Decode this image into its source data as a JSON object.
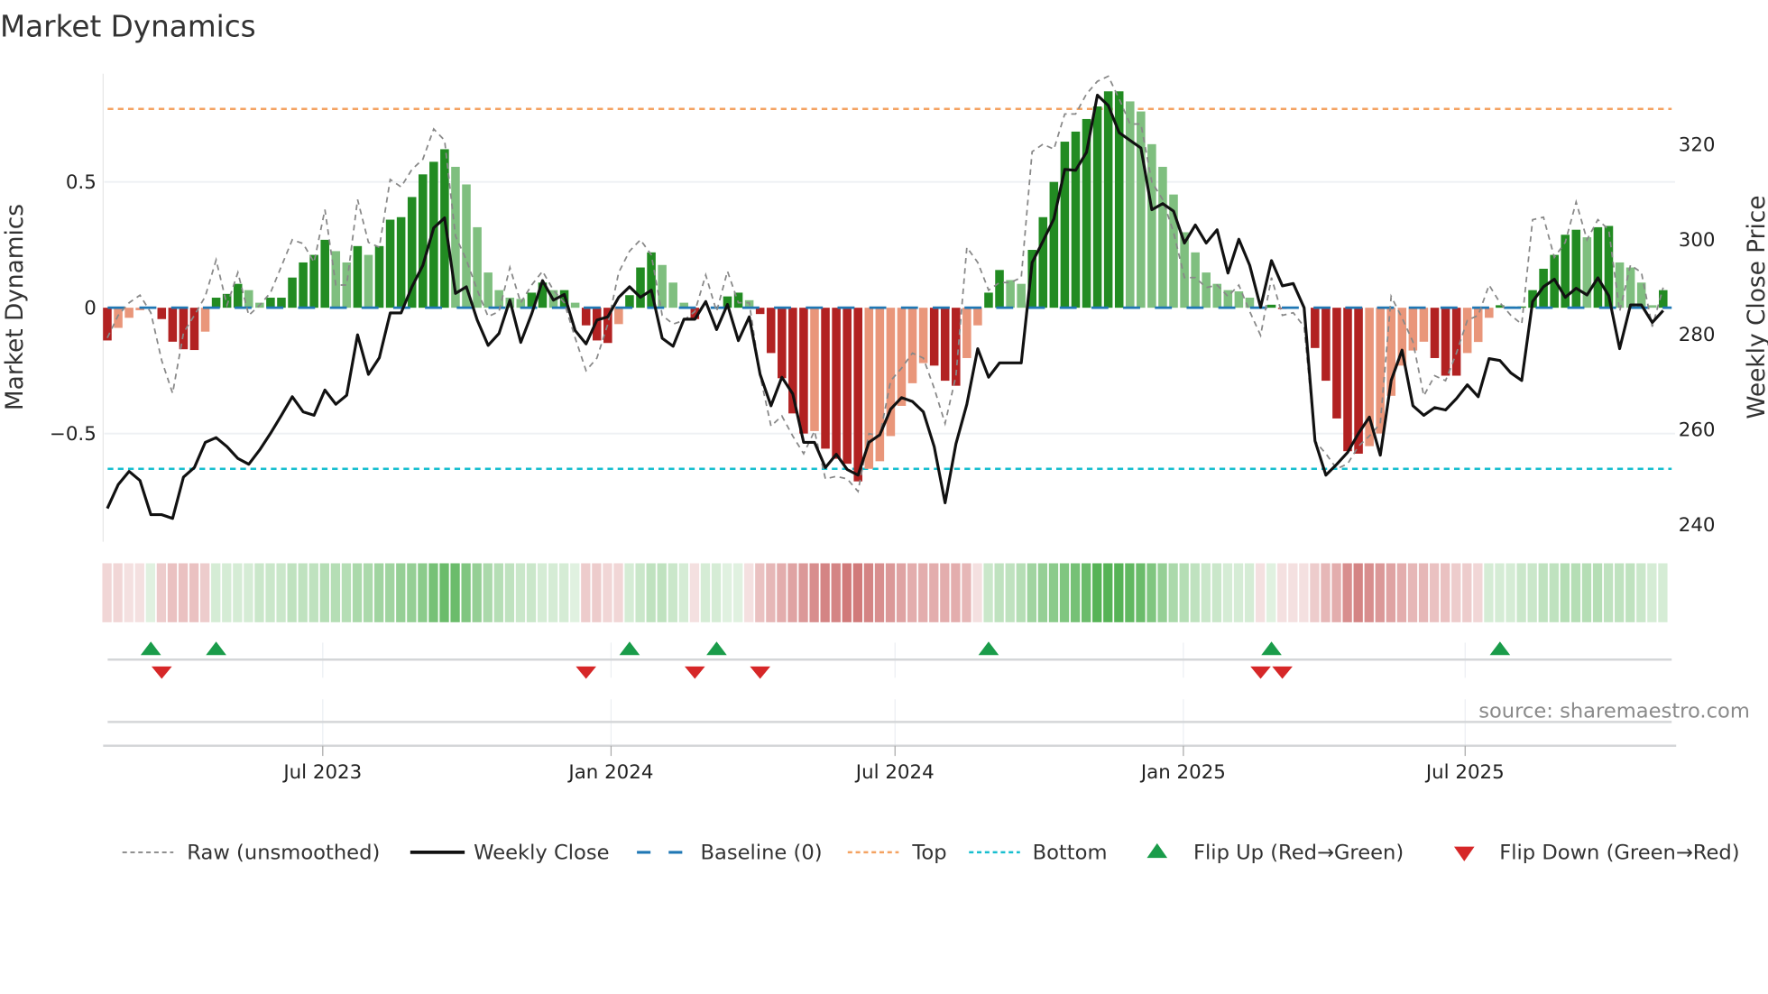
{
  "chart_data": {
    "type": "bar+line",
    "title": "Market Dynamics",
    "ylabel_left": "Market Dynamics",
    "ylabel_right": "Weekly Close Price",
    "source": "source: sharemaestro.com",
    "ylim_left": [
      -0.93,
      0.93
    ],
    "ylim_right": [
      236.4,
      334.8
    ],
    "left_ticks": [
      {
        "v": 0.5,
        "label": "0.5"
      },
      {
        "v": 0,
        "label": "0"
      },
      {
        "v": -0.5,
        "label": "−0.5"
      }
    ],
    "right_ticks": [
      {
        "v": 320,
        "label": "320"
      },
      {
        "v": 300,
        "label": "300"
      },
      {
        "v": 280,
        "label": "280"
      },
      {
        "v": 260,
        "label": "260"
      },
      {
        "v": 240,
        "label": "240"
      }
    ],
    "x_ticks": [
      {
        "week": 19.8,
        "label": "Jul 2023"
      },
      {
        "week": 46.3,
        "label": "Jan 2024"
      },
      {
        "week": 72.4,
        "label": "Jul 2024"
      },
      {
        "week": 98.9,
        "label": "Jan 2025"
      },
      {
        "week": 124.8,
        "label": "Jul 2025"
      }
    ],
    "top_level": 0.79,
    "bottom_level": -0.64,
    "baseline": 0,
    "momentum": [
      -0.13,
      -0.08,
      -0.04,
      -0.01,
      0,
      -0.045,
      -0.135,
      -0.165,
      -0.168,
      -0.095,
      0.04,
      0.055,
      0.095,
      0.07,
      0.02,
      0.04,
      0.04,
      0.12,
      0.18,
      0.21,
      0.27,
      0.225,
      0.18,
      0.245,
      0.21,
      0.245,
      0.35,
      0.36,
      0.44,
      0.53,
      0.58,
      0.63,
      0.56,
      0.49,
      0.32,
      0.14,
      0.07,
      0.04,
      0.035,
      0.06,
      0.1,
      0.07,
      0.07,
      0.02,
      -0.07,
      -0.13,
      -0.14,
      -0.065,
      0.05,
      0.16,
      0.22,
      0.17,
      0.1,
      0.02,
      -0.045,
      0,
      0,
      0.045,
      0.06,
      0.03,
      -0.025,
      -0.18,
      -0.28,
      -0.42,
      -0.5,
      -0.49,
      -0.56,
      -0.6,
      -0.62,
      -0.69,
      -0.64,
      -0.61,
      -0.51,
      -0.39,
      -0.3,
      -0.22,
      -0.23,
      -0.29,
      -0.31,
      -0.2,
      -0.07,
      0.06,
      0.15,
      0.11,
      0.095,
      0.23,
      0.36,
      0.5,
      0.66,
      0.7,
      0.75,
      0.8,
      0.86,
      0.86,
      0.82,
      0.78,
      0.65,
      0.56,
      0.45,
      0.3,
      0.22,
      0.14,
      0.095,
      0.07,
      0.065,
      0.04,
      0,
      0.012,
      -0.005,
      0,
      0,
      -0.16,
      -0.29,
      -0.44,
      -0.57,
      -0.58,
      -0.55,
      -0.5,
      -0.35,
      -0.23,
      -0.17,
      -0.135,
      -0.2,
      -0.27,
      -0.27,
      -0.18,
      -0.136,
      -0.04,
      0.01,
      0.005,
      0.005,
      0.07,
      0.155,
      0.21,
      0.29,
      0.31,
      0.28,
      0.32,
      0.325,
      0.18,
      0.16,
      0.1,
      0.01,
      0.07
    ],
    "raw": [
      -0.12,
      -0.03,
      0.02,
      0.05,
      -0.02,
      -0.21,
      -0.34,
      -0.1,
      -0.03,
      0.045,
      0.19,
      0.01,
      0.14,
      -0.03,
      0.01,
      0.06,
      0.165,
      0.27,
      0.255,
      0.18,
      0.39,
      0.09,
      0.09,
      0.43,
      0.26,
      0.24,
      0.51,
      0.48,
      0.55,
      0.59,
      0.71,
      0.665,
      0.285,
      0.19,
      0.07,
      -0.035,
      -0.015,
      0.16,
      0.02,
      0.09,
      0.145,
      0.07,
      0.02,
      -0.12,
      -0.25,
      -0.2,
      -0.065,
      0.14,
      0.225,
      0.27,
      0.21,
      -0.03,
      -0.065,
      -0.05,
      -0.015,
      0.13,
      -0.015,
      0.145,
      0.02,
      0.02,
      -0.27,
      -0.47,
      -0.43,
      -0.51,
      -0.58,
      -0.49,
      -0.68,
      -0.67,
      -0.68,
      -0.73,
      -0.5,
      -0.51,
      -0.29,
      -0.24,
      -0.18,
      -0.2,
      -0.32,
      -0.46,
      -0.27,
      0.24,
      0.18,
      0.07,
      0.1,
      0.1,
      0.12,
      0.62,
      0.65,
      0.63,
      0.77,
      0.77,
      0.85,
      0.9,
      0.92,
      0.83,
      0.73,
      0.73,
      0.5,
      0.43,
      0.3,
      0.12,
      0.12,
      0.08,
      0.09,
      0.045,
      0.09,
      -0.015,
      -0.11,
      0.12,
      -0.03,
      -0.02,
      -0.075,
      -0.53,
      -0.58,
      -0.64,
      -0.62,
      -0.55,
      -0.51,
      -0.46,
      0.045,
      -0.04,
      -0.135,
      -0.35,
      -0.27,
      -0.29,
      -0.18,
      -0.05,
      -0.03,
      0.09,
      0.02,
      -0.03,
      -0.065,
      0.35,
      0.36,
      0.2,
      0.26,
      0.42,
      0.27,
      0.35,
      0.31,
      -0.015,
      0.17,
      0.14,
      -0.075,
      0.08
    ],
    "close": [
      243.4,
      248.4,
      251.2,
      249.3,
      242.1,
      242.1,
      241.3,
      250,
      252,
      257.3,
      258.3,
      256.4,
      253.9,
      252.7,
      255.7,
      259.2,
      263,
      266.9,
      263.7,
      263,
      268.3,
      265.3,
      267.2,
      279.9,
      271.6,
      275.1,
      284.5,
      284.5,
      290,
      294.5,
      302.4,
      304.5,
      288.6,
      290,
      283,
      277.7,
      280.2,
      287.2,
      278.3,
      284.3,
      291.3,
      287.2,
      288.4,
      280.8,
      278,
      283,
      283.7,
      287.8,
      290,
      287.8,
      289.3,
      279.2,
      277.5,
      283.2,
      283.2,
      286.9,
      281,
      286.3,
      278.7,
      283.7,
      271.6,
      265,
      271,
      267.5,
      257.3,
      257.3,
      252,
      254.8,
      251.6,
      250.4,
      257.3,
      258.9,
      264.3,
      266.7,
      265.9,
      263.7,
      256.4,
      244.6,
      257,
      265.3,
      277,
      271,
      274,
      274,
      274,
      295.1,
      299.6,
      304.3,
      314.7,
      314.5,
      318.3,
      330.3,
      328.1,
      322.4,
      320.8,
      319.2,
      306.2,
      307.5,
      305.9,
      299.2,
      303,
      299.2,
      302,
      292.9,
      300,
      294.5,
      285.7,
      295.5,
      290.2,
      290.7,
      285.6,
      257.6,
      250.4,
      252.7,
      255.2,
      259.2,
      262.6,
      254.6,
      270.3,
      276.7,
      265,
      263,
      264.6,
      264.1,
      266.5,
      269.4,
      266.9,
      274.9,
      274.5,
      271.9,
      270.3,
      286.9,
      290,
      291.6,
      287.8,
      289.7,
      288.3,
      291.9,
      288.1,
      277,
      286.2,
      286.2,
      282.5,
      285
    ],
    "regime_strip": [
      -0.2,
      -0.2,
      -0.15,
      -0.15,
      0.15,
      -0.25,
      -0.3,
      -0.3,
      -0.3,
      -0.25,
      0.2,
      0.2,
      0.2,
      0.2,
      0.25,
      0.25,
      0.25,
      0.3,
      0.3,
      0.3,
      0.35,
      0.35,
      0.35,
      0.4,
      0.4,
      0.45,
      0.45,
      0.5,
      0.5,
      0.55,
      0.65,
      0.7,
      0.7,
      0.6,
      0.5,
      0.4,
      0.35,
      0.3,
      0.25,
      0.25,
      0.2,
      0.2,
      0.2,
      0.15,
      -0.25,
      -0.25,
      -0.2,
      -0.2,
      0.2,
      0.25,
      0.3,
      0.3,
      0.25,
      0.2,
      -0.1,
      0.2,
      0.2,
      0.15,
      0.15,
      -0.1,
      -0.3,
      -0.35,
      -0.4,
      -0.45,
      -0.5,
      -0.55,
      -0.6,
      -0.6,
      -0.65,
      -0.65,
      -0.6,
      -0.55,
      -0.5,
      -0.45,
      -0.4,
      -0.4,
      -0.4,
      -0.4,
      -0.4,
      -0.35,
      -0.15,
      0.25,
      0.3,
      0.3,
      0.35,
      0.45,
      0.5,
      0.55,
      0.6,
      0.65,
      0.7,
      0.8,
      0.8,
      0.8,
      0.75,
      0.7,
      0.6,
      0.5,
      0.4,
      0.35,
      0.3,
      0.25,
      0.25,
      0.2,
      0.2,
      0.2,
      -0.1,
      0.15,
      -0.15,
      -0.15,
      -0.15,
      -0.25,
      -0.35,
      -0.4,
      -0.55,
      -0.6,
      -0.55,
      -0.5,
      -0.45,
      -0.4,
      -0.35,
      -0.35,
      -0.3,
      -0.3,
      -0.25,
      -0.25,
      -0.2,
      0.2,
      0.2,
      0.2,
      0.25,
      0.25,
      0.3,
      0.3,
      0.35,
      0.35,
      0.35,
      0.35,
      0.3,
      0.3,
      0.3,
      0.25,
      0.2,
      0.2
    ],
    "flip_up_weeks": [
      4,
      10,
      48,
      56,
      81,
      107,
      128
    ],
    "flip_down_weeks": [
      5,
      44,
      54,
      60,
      106,
      108
    ],
    "legend": [
      "Raw (unsmoothed)",
      "Weekly Close",
      "Baseline (0)",
      "Top",
      "Bottom",
      "Flip Up (Red→Green)",
      "Flip Down (Green→Red)"
    ],
    "legend_placement": "bottom",
    "colors": {
      "bar_pos_strong": "#228b22",
      "bar_pos_weak": "#7fbf7f",
      "bar_neg_strong": "#b22222",
      "bar_neg_weak": "#e9967a",
      "raw": "#888888",
      "close": "#111111",
      "baseline": "#1f77b4",
      "top": "#f4a261",
      "bottom": "#17becf",
      "flip_up": "#1a9c4a",
      "flip_down": "#d62728",
      "strip_green": "#2ca02c",
      "strip_red": "#b83232"
    }
  }
}
